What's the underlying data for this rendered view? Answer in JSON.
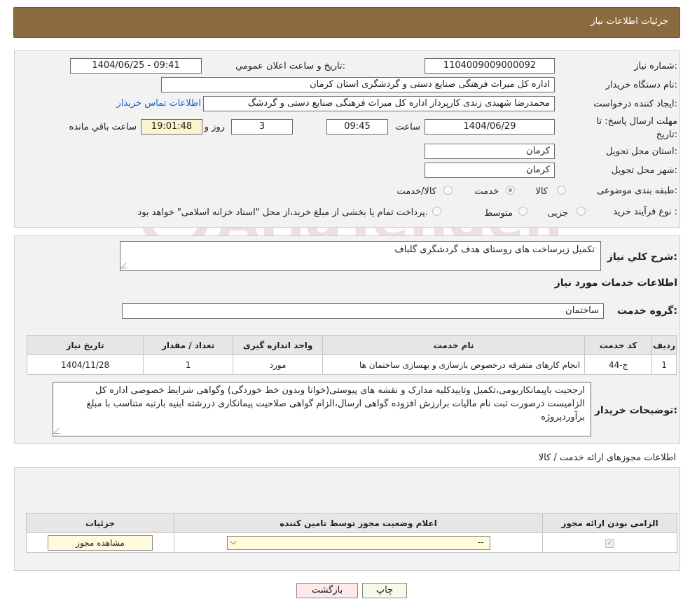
{
  "header": {
    "title": "جزئیات اطلاعات نیاز"
  },
  "details": {
    "need_number_label": "شماره نیاز:",
    "need_number": "1104009009000092",
    "announce_label": "تاریخ و ساعت اعلان عمومي:",
    "announce_value": "1404/06/25 - 09:41",
    "buyer_org_label": "نام دستگاه خریدار:",
    "buyer_org": "اداره کل میراث فرهنگی  صنایع دستی و گردشگری استان کرمان",
    "creator_label": "ایجاد کننده درخواست:",
    "creator": "محمدرضا شهیدی زندی کارپرداز اداره کل میراث فرهنگی  صنایع دستی و گردشگ",
    "contact_link": "اطلاعات تماس خریدار",
    "deadline_label": "مهلت ارسال پاسخ: تا تاریخ:",
    "deadline_date": "1404/06/29",
    "time_label": "ساعت",
    "deadline_time": "09:45",
    "days_value": "3",
    "days_label": "روز و",
    "remaining_time": "19:01:48",
    "remaining_label": "ساعت باقي مانده",
    "province_label": "استان محل تحویل:",
    "province": "کرمان",
    "city_label": "شهر محل تحویل:",
    "city": "کرمان",
    "category_label": "طبقه بندی موضوعی:",
    "category_options": [
      "کالا",
      "خدمت",
      "کالا/خدمت"
    ],
    "category_selected": "خدمت",
    "process_label": "نوع فرآیند خرید :",
    "process_options": [
      "جزیی",
      "متوسط"
    ],
    "process_note": "پرداخت تمام یا بخشی از مبلغ خرید،از محل \"اسناد خزانه اسلامی\" خواهد بود."
  },
  "watermark_text": "AriaTender.neT",
  "summary": {
    "label": "شرح کلي نیاز:",
    "value": "تکمیل زیرساخت های روستای هدف گردشگری گلباف",
    "services_title": "اطلاعات خدمات مورد نیاز",
    "group_label": "گروه خدمت:",
    "group_value": "ساختمان"
  },
  "services_table": {
    "headers": [
      "ردیف",
      "کد خدمت",
      "نام خدمت",
      "واحد اندازه گیری",
      "تعداد / مقدار",
      "تاریخ نیاز"
    ],
    "rows": [
      [
        "1",
        "ج-44",
        "انجام کارهای متفرقه درخصوص بازسازی و بهسازی ساختمان ها",
        "مورد",
        "1",
        "1404/11/28"
      ]
    ]
  },
  "buyer_notes": {
    "label": "توضیحات خریدار:",
    "text": "ارجحیت باپیمانکاربومی،تکمیل وتاییدکلیه مدارک و نقشه های پیوستی(خوانا وبدون خط خوردگی) وگواهی شرایط خصوصی اداره کل الزامیست درصورت ثبت نام مالیات برارزش افزوده گواهی ارسال،الزام گواهی صلاحیت پیمانکاری دررشته ابنیه بارتبه متناسب با مبلغ برآوردپروژه"
  },
  "permits": {
    "title": "اطلاعات مجوزهای ارائه خدمت / کالا",
    "headers": [
      "الزامی بودن ارائه مجوز",
      "اعلام وضعیت مجوز توسط تامین کننده",
      "جزئیات"
    ],
    "select_value": "--",
    "view_button": "مشاهده مجوز"
  },
  "actions": {
    "print": "چاپ",
    "back": "بازگشت"
  }
}
